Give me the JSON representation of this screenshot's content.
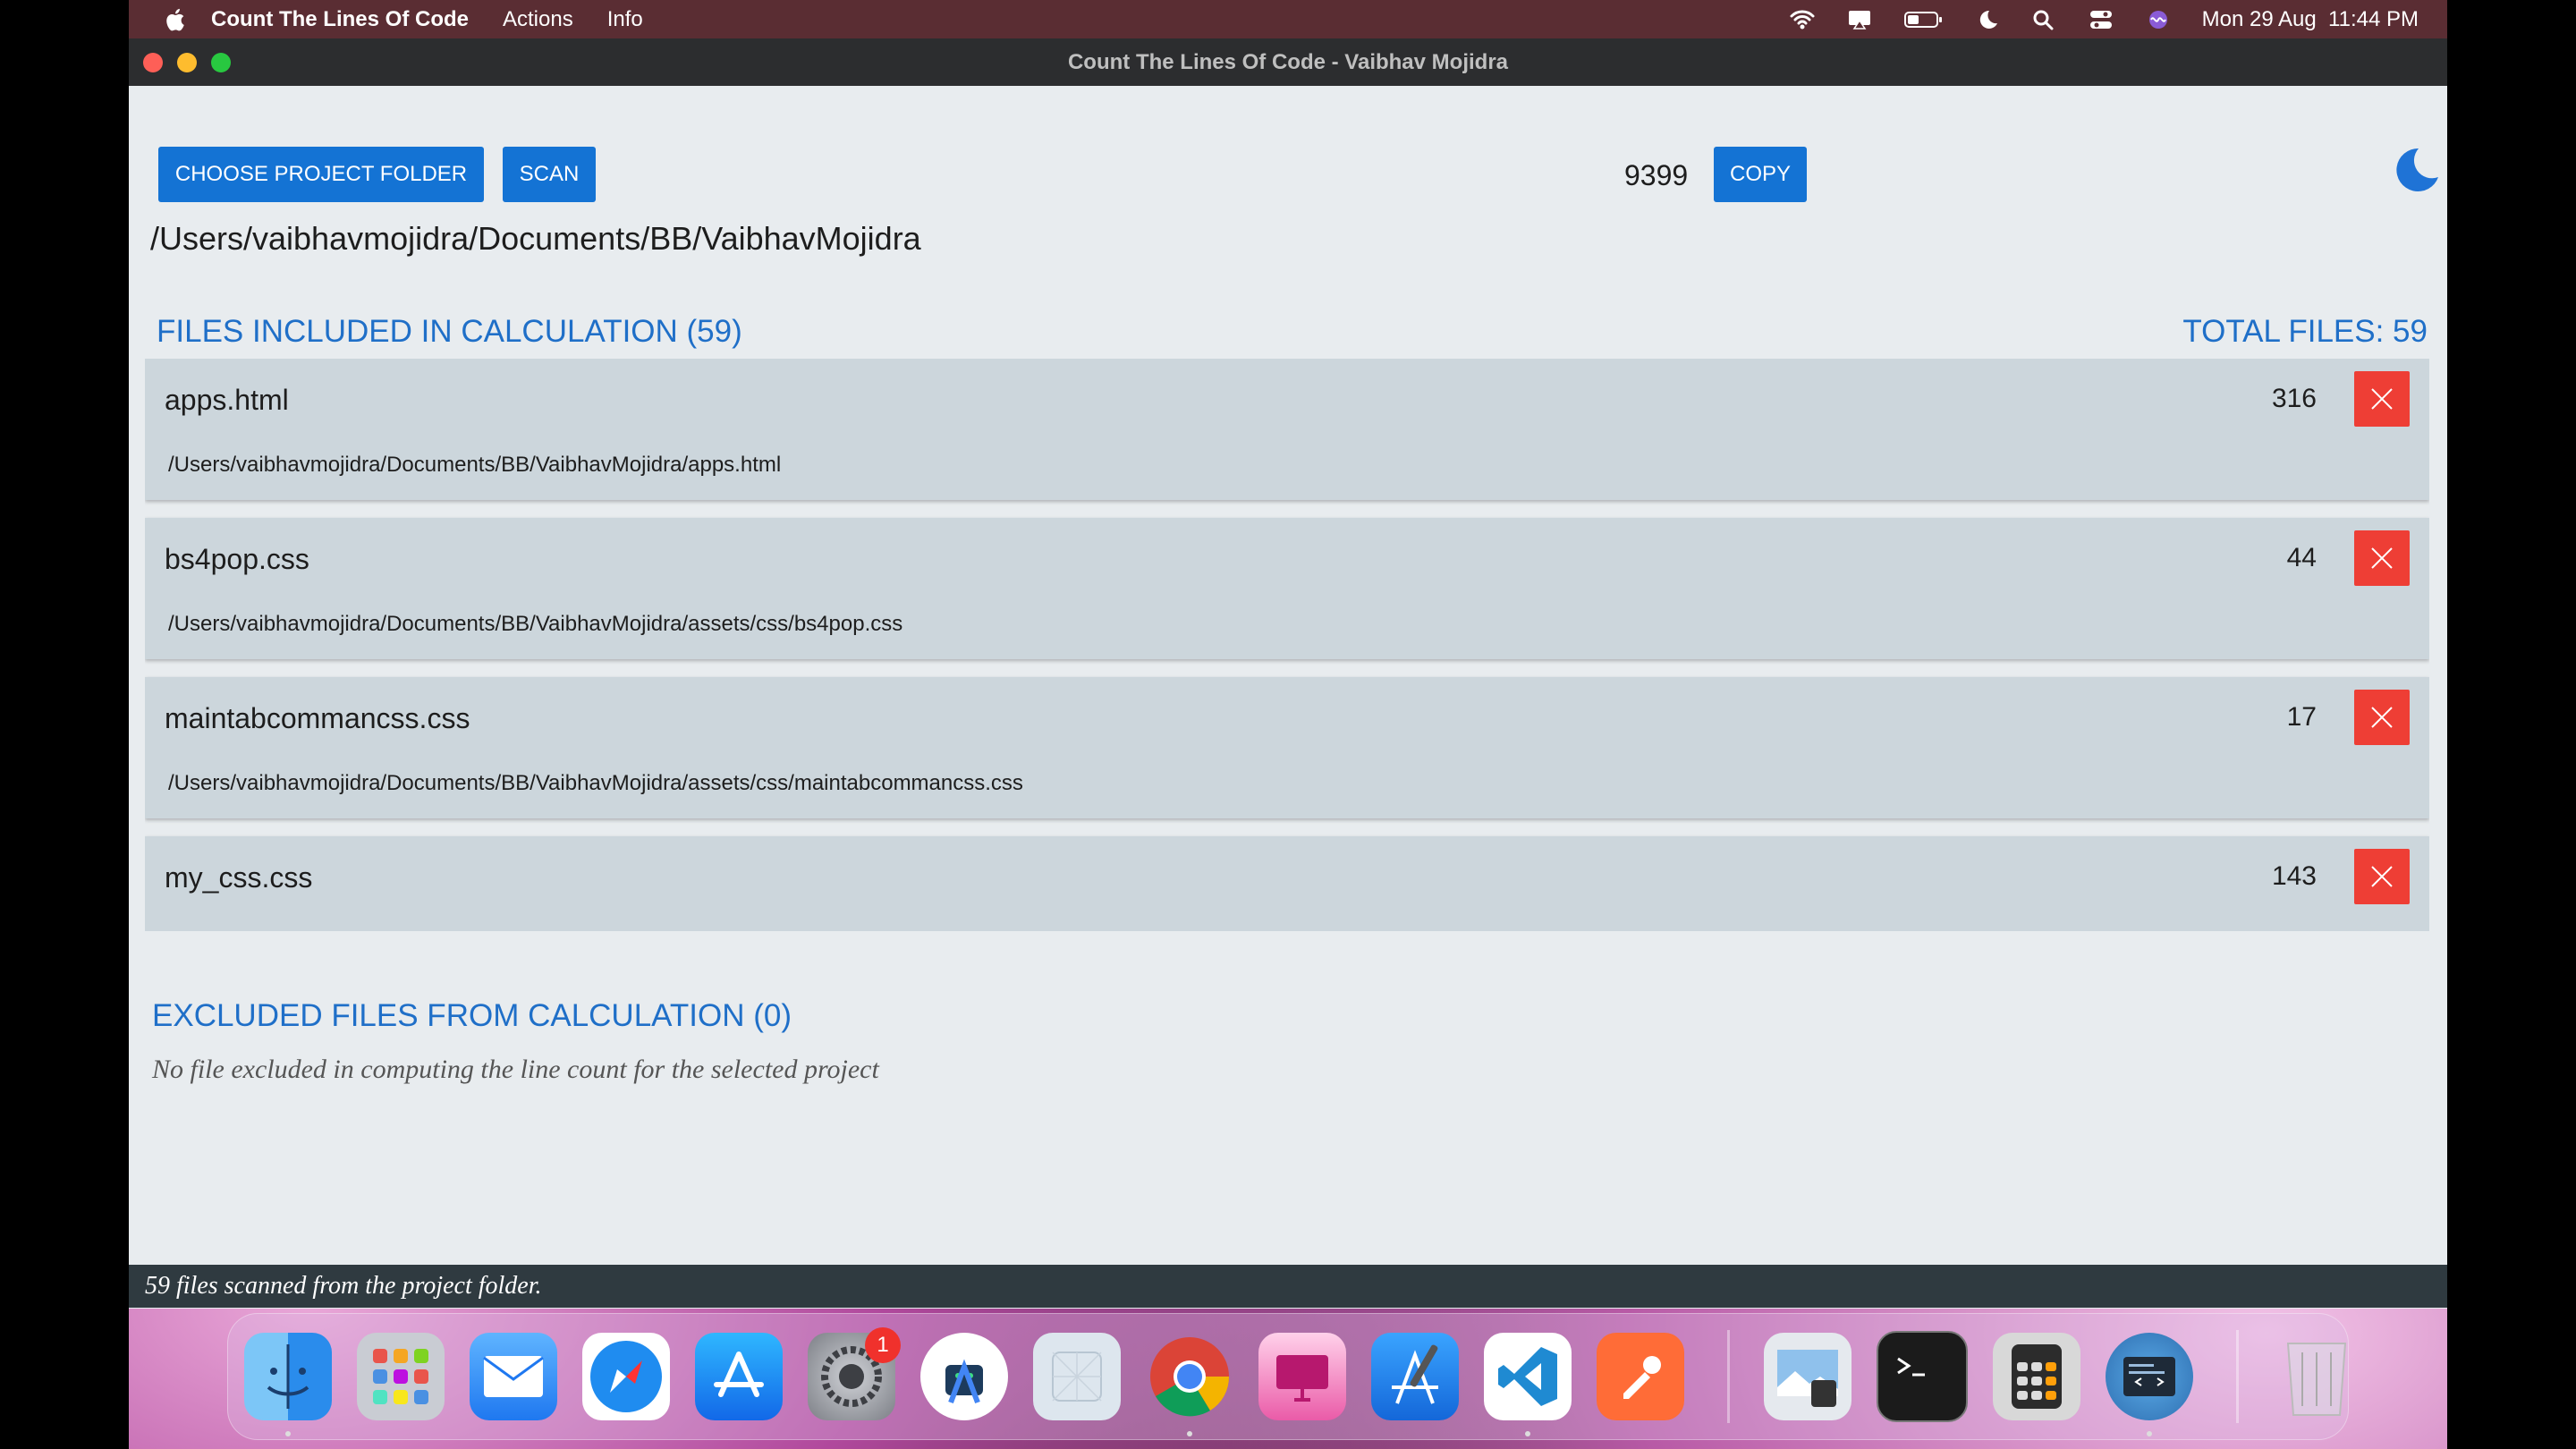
{
  "menubar": {
    "app_name": "Count The Lines Of Code",
    "menus": [
      "Actions",
      "Info"
    ],
    "datetime": "Mon 29 Aug  11:44 PM"
  },
  "window": {
    "title": "Count The Lines Of Code - Vaibhav Mojidra"
  },
  "toolbar": {
    "choose_label": "CHOOSE PROJECT FOLDER",
    "scan_label": "SCAN",
    "total_lines": "9399",
    "copy_label": "COPY",
    "theme_icon": "moon-icon"
  },
  "project_path": "/Users/vaibhavmojidra/Documents/BB/VaibhavMojidra",
  "included": {
    "title": "FILES INCLUDED IN CALCULATION (59)",
    "total_files": "TOTAL FILES: 59",
    "files": [
      {
        "name": "apps.html",
        "lines": "316",
        "path": "/Users/vaibhavmojidra/Documents/BB/VaibhavMojidra/apps.html"
      },
      {
        "name": "bs4pop.css",
        "lines": "44",
        "path": "/Users/vaibhavmojidra/Documents/BB/VaibhavMojidra/assets/css/bs4pop.css"
      },
      {
        "name": "maintabcommancss.css",
        "lines": "17",
        "path": "/Users/vaibhavmojidra/Documents/BB/VaibhavMojidra/assets/css/maintabcommancss.css"
      },
      {
        "name": "my_css.css",
        "lines": "143",
        "path": ""
      }
    ]
  },
  "excluded": {
    "title": "EXCLUDED FILES FROM CALCULATION (0)",
    "note": "No file excluded in computing the line count for the selected project"
  },
  "status": "59 files scanned from the project folder.",
  "dock": {
    "settings_badge": "1",
    "apps": [
      "finder-icon",
      "launchpad-icon",
      "mail-icon",
      "safari-icon",
      "app-store-icon",
      "system-settings-icon",
      "android-studio-icon",
      "simulator-icon",
      "chrome-icon",
      "design-app-icon",
      "xcode-icon",
      "vscode-icon",
      "postman-icon",
      "preview-icon",
      "terminal-icon",
      "calculator-icon",
      "code-app-icon",
      "trash-icon"
    ]
  }
}
